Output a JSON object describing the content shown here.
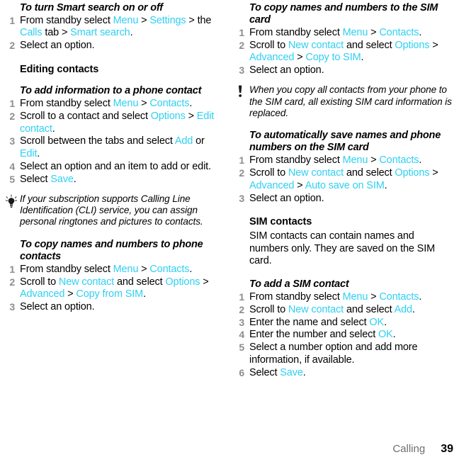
{
  "document": {
    "footer": {
      "chapter": "Calling",
      "page_number": "39"
    }
  },
  "colors": {
    "ui_highlight": "#2fd0f2",
    "step_number": "#8d8d8d",
    "body_text": "#000000",
    "footer_chapter": "#6f6f6f"
  },
  "left_column": {
    "proc_smart_search": {
      "heading": "To turn Smart search on or off",
      "steps": [
        {
          "parts": [
            {
              "t": "From standby select ",
              "s": "plain"
            },
            {
              "t": "Menu",
              "s": "ui"
            },
            {
              "t": " > ",
              "s": "plain"
            },
            {
              "t": "Settings",
              "s": "ui"
            },
            {
              "t": " > the ",
              "s": "plain"
            },
            {
              "t": "Calls",
              "s": "ui"
            },
            {
              "t": " tab > ",
              "s": "plain"
            },
            {
              "t": "Smart search",
              "s": "ui"
            },
            {
              "t": ".",
              "s": "plain"
            }
          ]
        },
        {
          "parts": [
            {
              "t": "Select an option.",
              "s": "plain"
            }
          ]
        }
      ]
    },
    "section_editing_contacts": "Editing contacts",
    "proc_add_info": {
      "heading": "To add information to a phone contact",
      "steps": [
        {
          "parts": [
            {
              "t": "From standby select ",
              "s": "plain"
            },
            {
              "t": "Menu",
              "s": "ui"
            },
            {
              "t": " >  ",
              "s": "plain"
            },
            {
              "t": "Contacts",
              "s": "ui"
            },
            {
              "t": ".",
              "s": "plain"
            }
          ]
        },
        {
          "parts": [
            {
              "t": "Scroll to a contact and select ",
              "s": "plain"
            },
            {
              "t": "Options",
              "s": "ui"
            },
            {
              "t": " > ",
              "s": "plain"
            },
            {
              "t": "Edit contact",
              "s": "ui"
            },
            {
              "t": ".",
              "s": "plain"
            }
          ]
        },
        {
          "parts": [
            {
              "t": "Scroll between the tabs and select ",
              "s": "plain"
            },
            {
              "t": "Add",
              "s": "ui"
            },
            {
              "t": " or ",
              "s": "plain"
            },
            {
              "t": "Edit",
              "s": "ui"
            },
            {
              "t": ".",
              "s": "plain"
            }
          ]
        },
        {
          "parts": [
            {
              "t": "Select an option and an item to add or edit.",
              "s": "plain"
            }
          ]
        },
        {
          "parts": [
            {
              "t": "Select ",
              "s": "plain"
            },
            {
              "t": "Save",
              "s": "ui"
            },
            {
              "t": ".",
              "s": "plain"
            }
          ]
        }
      ]
    },
    "tip_note": {
      "icon": "lightbulb-icon",
      "text": "If your subscription supports Calling Line Identification (CLI) service, you can assign personal ringtones and pictures to contacts."
    },
    "proc_copy_to_phone": {
      "heading": "To copy names and numbers to phone contacts",
      "steps": [
        {
          "parts": [
            {
              "t": "From standby select ",
              "s": "plain"
            },
            {
              "t": "Menu",
              "s": "ui"
            },
            {
              "t": " >  ",
              "s": "plain"
            },
            {
              "t": "Contacts",
              "s": "ui"
            },
            {
              "t": ".",
              "s": "plain"
            }
          ]
        },
        {
          "parts": [
            {
              "t": "Scroll to ",
              "s": "plain"
            },
            {
              "t": "New contact",
              "s": "ui"
            },
            {
              "t": " and select ",
              "s": "plain"
            },
            {
              "t": "Options",
              "s": "ui"
            },
            {
              "t": " > ",
              "s": "plain"
            },
            {
              "t": "Advanced",
              "s": "ui"
            },
            {
              "t": " > ",
              "s": "plain"
            },
            {
              "t": "Copy from SIM",
              "s": "ui"
            },
            {
              "t": ".",
              "s": "plain"
            }
          ]
        },
        {
          "parts": [
            {
              "t": "Select an option.",
              "s": "plain"
            }
          ]
        }
      ]
    }
  },
  "right_column": {
    "proc_copy_to_sim": {
      "heading": "To copy names and numbers to the SIM card",
      "steps": [
        {
          "parts": [
            {
              "t": "From standby select ",
              "s": "plain"
            },
            {
              "t": "Menu",
              "s": "ui"
            },
            {
              "t": " >  ",
              "s": "plain"
            },
            {
              "t": "Contacts",
              "s": "ui"
            },
            {
              "t": ".",
              "s": "plain"
            }
          ]
        },
        {
          "parts": [
            {
              "t": "Scroll to ",
              "s": "plain"
            },
            {
              "t": "New contact",
              "s": "ui"
            },
            {
              "t": " and select ",
              "s": "plain"
            },
            {
              "t": "Options",
              "s": "ui"
            },
            {
              "t": " > ",
              "s": "plain"
            },
            {
              "t": "Advanced",
              "s": "ui"
            },
            {
              "t": " > ",
              "s": "plain"
            },
            {
              "t": "Copy to SIM",
              "s": "ui"
            },
            {
              "t": ".",
              "s": "plain"
            }
          ]
        },
        {
          "parts": [
            {
              "t": "Select an option.",
              "s": "plain"
            }
          ]
        }
      ]
    },
    "warning_note": {
      "icon": "exclamation-icon",
      "text": "When you copy all contacts from your phone to the SIM card, all existing SIM card information is replaced."
    },
    "proc_auto_save": {
      "heading": "To automatically save names and phone numbers on the SIM card",
      "steps": [
        {
          "parts": [
            {
              "t": "From standby select ",
              "s": "plain"
            },
            {
              "t": "Menu",
              "s": "ui"
            },
            {
              "t": " >  ",
              "s": "plain"
            },
            {
              "t": "Contacts",
              "s": "ui"
            },
            {
              "t": ".",
              "s": "plain"
            }
          ]
        },
        {
          "parts": [
            {
              "t": "Scroll to ",
              "s": "plain"
            },
            {
              "t": "New contact",
              "s": "ui"
            },
            {
              "t": " and select ",
              "s": "plain"
            },
            {
              "t": "Options",
              "s": "ui"
            },
            {
              "t": " > ",
              "s": "plain"
            },
            {
              "t": "Advanced",
              "s": "ui"
            },
            {
              "t": " > ",
              "s": "plain"
            },
            {
              "t": "Auto save on SIM",
              "s": "ui"
            },
            {
              "t": ".",
              "s": "plain"
            }
          ]
        },
        {
          "parts": [
            {
              "t": "Select an option.",
              "s": "plain"
            }
          ]
        }
      ]
    },
    "section_sim_contacts": {
      "heading": "SIM contacts",
      "body": "SIM contacts can contain names and numbers only. They are saved on the SIM card."
    },
    "proc_add_sim_contact": {
      "heading": "To add a SIM contact",
      "steps": [
        {
          "parts": [
            {
              "t": "From standby select ",
              "s": "plain"
            },
            {
              "t": "Menu",
              "s": "ui"
            },
            {
              "t": " >  ",
              "s": "plain"
            },
            {
              "t": "Contacts",
              "s": "ui"
            },
            {
              "t": ".",
              "s": "plain"
            }
          ]
        },
        {
          "parts": [
            {
              "t": "Scroll to ",
              "s": "plain"
            },
            {
              "t": "New contact",
              "s": "ui"
            },
            {
              "t": " and select ",
              "s": "plain"
            },
            {
              "t": "Add",
              "s": "ui"
            },
            {
              "t": ".",
              "s": "plain"
            }
          ]
        },
        {
          "parts": [
            {
              "t": "Enter the name and select ",
              "s": "plain"
            },
            {
              "t": "OK",
              "s": "ui"
            },
            {
              "t": ".",
              "s": "plain"
            }
          ]
        },
        {
          "parts": [
            {
              "t": "Enter the number and select ",
              "s": "plain"
            },
            {
              "t": "OK",
              "s": "ui"
            },
            {
              "t": ".",
              "s": "plain"
            }
          ]
        },
        {
          "parts": [
            {
              "t": "Select a number option and add more information, if available.",
              "s": "plain"
            }
          ]
        },
        {
          "parts": [
            {
              "t": "Select ",
              "s": "plain"
            },
            {
              "t": "Save",
              "s": "ui"
            },
            {
              "t": ".",
              "s": "plain"
            }
          ]
        }
      ]
    }
  }
}
